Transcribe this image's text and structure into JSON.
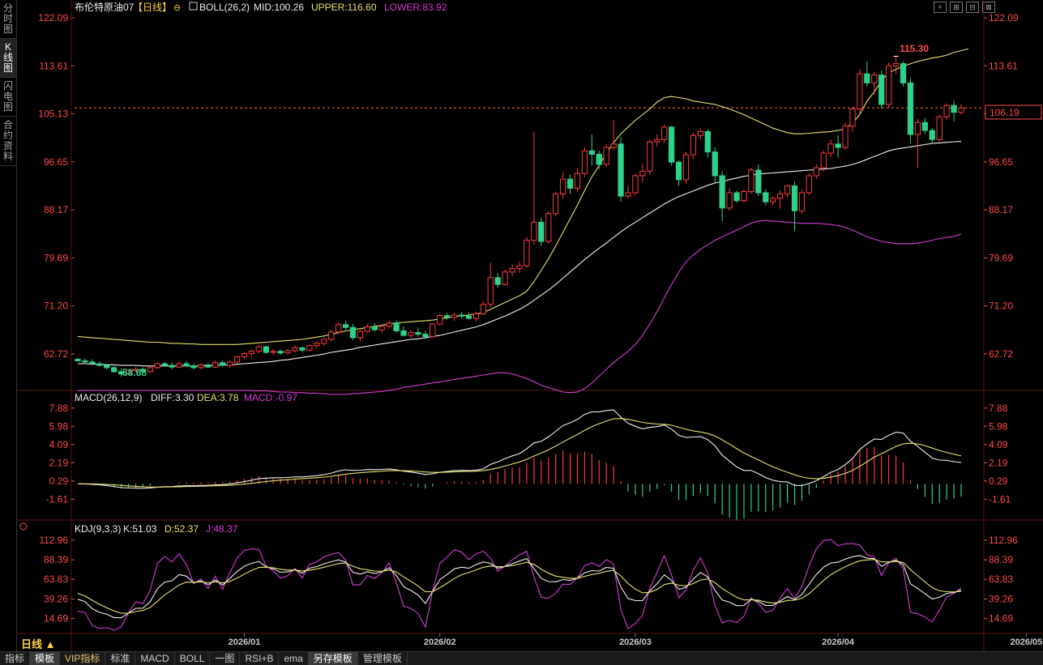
{
  "sidebar": {
    "tabs": [
      {
        "label": "分时图",
        "active": false
      },
      {
        "label": "K线图",
        "active": true
      },
      {
        "label": "闪电图",
        "active": false
      },
      {
        "label": "合约资料",
        "active": false
      }
    ]
  },
  "window_controls": [
    "+",
    "⊞",
    "⊟",
    "⊠"
  ],
  "main_panel": {
    "instrument": "布伦特原油07",
    "period": "【日线】",
    "indicator": "BOLL(26,2)",
    "mid": "MID:100.26",
    "upper": "UPPER:116.60",
    "lower": "LOWER:83.92",
    "current_price": "106.19",
    "high_label": "115.30",
    "low_label": "58.68"
  },
  "macd_panel": {
    "name": "MACD(26,12,9)",
    "diff": "DIFF:3.30",
    "dea": "DEA:3.78",
    "macd": "MACD:-0.97"
  },
  "kdj_panel": {
    "name": "KDJ(9,3,3)",
    "k": "K:51.03",
    "d": "D:52.37",
    "j": "J:48.37"
  },
  "ribbon_label": "日线",
  "bottom_tabs": [
    {
      "label": "指标",
      "style": ""
    },
    {
      "label": "模板",
      "style": "hl"
    },
    {
      "label": "VIP指标",
      "style": "vip"
    },
    {
      "label": "标准",
      "style": ""
    },
    {
      "label": "MACD",
      "style": ""
    },
    {
      "label": "BOLL",
      "style": ""
    },
    {
      "label": "一图",
      "style": ""
    },
    {
      "label": "RSI+B",
      "style": ""
    },
    {
      "label": "ema",
      "style": ""
    },
    {
      "label": "另存模板",
      "style": "hl"
    },
    {
      "label": "管理模板",
      "style": ""
    }
  ],
  "colors": {
    "up": "#ff3b3b",
    "down": "#2ed18a",
    "upper": "#e9e36a",
    "mid": "#f0f0f0",
    "lower": "#d63cd6",
    "diff": "#f0f0f0",
    "dea": "#e9e36a",
    "k": "#f0f0f0",
    "d": "#e9e36a",
    "j": "#d63cd6",
    "axis_text": "#ff4a4a",
    "grid": "#3a1010"
  },
  "chart_data": [
    {
      "type": "candlestick",
      "name": "main",
      "yticks": [
        62.72,
        71.2,
        79.69,
        88.17,
        96.65,
        105.13,
        113.61,
        122.09
      ],
      "ytick_labels": [
        "62.72",
        "71.20",
        "79.69",
        "88.17",
        "96.65",
        "105.13",
        "113.61",
        "122.09"
      ],
      "ylim": [
        58.0,
        122.09
      ],
      "x_labels": [
        {
          "index": 23,
          "label": "2026/01"
        },
        {
          "index": 50,
          "label": "2026/02"
        },
        {
          "index": 77,
          "label": "2026/03"
        },
        {
          "index": 105,
          "label": "2026/04"
        },
        {
          "index": 131,
          "label": "2026/05"
        }
      ],
      "ohlc": [
        [
          61.8,
          62.0,
          61.4,
          61.5
        ],
        [
          61.5,
          61.9,
          61.0,
          61.3
        ],
        [
          61.3,
          61.8,
          60.9,
          61.0
        ],
        [
          61.0,
          61.4,
          60.5,
          60.7
        ],
        [
          60.7,
          61.0,
          60.0,
          60.3
        ],
        [
          60.3,
          60.6,
          59.4,
          59.6
        ],
        [
          59.6,
          60.2,
          58.7,
          59.2
        ],
        [
          59.2,
          60.0,
          59.0,
          59.8
        ],
        [
          59.8,
          60.4,
          59.5,
          60.0
        ],
        [
          60.0,
          60.3,
          59.4,
          59.6
        ],
        [
          59.6,
          60.5,
          59.4,
          60.3
        ],
        [
          60.3,
          61.2,
          60.1,
          61.0
        ],
        [
          61.0,
          61.3,
          60.5,
          60.7
        ],
        [
          60.7,
          61.2,
          60.0,
          60.4
        ],
        [
          60.4,
          61.4,
          60.2,
          61.0
        ],
        [
          61.0,
          61.5,
          60.4,
          60.6
        ],
        [
          60.6,
          61.0,
          60.0,
          60.3
        ],
        [
          60.3,
          61.0,
          60.1,
          60.8
        ],
        [
          60.8,
          61.0,
          60.3,
          60.4
        ],
        [
          60.4,
          61.6,
          60.2,
          61.2
        ],
        [
          61.2,
          61.6,
          60.5,
          60.7
        ],
        [
          60.7,
          61.5,
          60.2,
          61.3
        ],
        [
          61.3,
          62.4,
          61.0,
          62.2
        ],
        [
          62.2,
          63.0,
          61.8,
          62.8
        ],
        [
          62.8,
          63.5,
          62.2,
          63.2
        ],
        [
          63.2,
          64.4,
          62.8,
          64.0
        ],
        [
          64.0,
          64.2,
          62.8,
          63.0
        ],
        [
          63.0,
          63.6,
          62.5,
          63.2
        ],
        [
          63.2,
          63.5,
          62.6,
          62.9
        ],
        [
          62.9,
          63.6,
          62.6,
          63.3
        ],
        [
          63.3,
          64.2,
          63.0,
          63.8
        ],
        [
          63.8,
          64.0,
          63.0,
          63.4
        ],
        [
          63.4,
          64.4,
          63.2,
          64.2
        ],
        [
          64.2,
          65.0,
          63.8,
          64.6
        ],
        [
          64.6,
          65.6,
          64.2,
          65.3
        ],
        [
          65.3,
          67.0,
          65.0,
          66.6
        ],
        [
          66.6,
          68.3,
          66.2,
          67.9
        ],
        [
          67.9,
          68.6,
          67.0,
          67.4
        ],
        [
          67.4,
          68.0,
          65.2,
          65.6
        ],
        [
          65.6,
          67.0,
          65.0,
          66.7
        ],
        [
          66.7,
          68.0,
          66.4,
          67.5
        ],
        [
          67.5,
          68.2,
          66.6,
          67.0
        ],
        [
          67.0,
          68.0,
          66.5,
          67.6
        ],
        [
          67.6,
          68.6,
          67.2,
          68.2
        ],
        [
          68.2,
          68.7,
          66.5,
          66.8
        ],
        [
          66.8,
          67.6,
          65.8,
          66.0
        ],
        [
          66.0,
          67.0,
          65.6,
          66.5
        ],
        [
          66.5,
          67.4,
          65.8,
          66.2
        ],
        [
          66.2,
          66.8,
          65.4,
          65.8
        ],
        [
          65.8,
          68.2,
          65.6,
          68.0
        ],
        [
          68.0,
          69.8,
          67.8,
          69.5
        ],
        [
          69.5,
          70.0,
          68.8,
          69.2
        ],
        [
          69.2,
          70.0,
          68.6,
          69.6
        ],
        [
          69.6,
          70.2,
          69.0,
          69.4
        ],
        [
          69.4,
          70.0,
          68.8,
          69.0
        ],
        [
          69.0,
          70.2,
          68.4,
          69.8
        ],
        [
          69.8,
          72.0,
          69.6,
          71.5
        ],
        [
          71.5,
          78.8,
          71.0,
          76.2
        ],
        [
          76.2,
          77.0,
          74.4,
          75.0
        ],
        [
          75.0,
          77.6,
          74.8,
          77.2
        ],
        [
          77.2,
          78.6,
          76.4,
          77.8
        ],
        [
          77.8,
          79.0,
          77.0,
          78.3
        ],
        [
          78.3,
          83.4,
          78.0,
          82.8
        ],
        [
          82.8,
          102.0,
          82.0,
          86.0
        ],
        [
          86.0,
          86.8,
          81.8,
          82.6
        ],
        [
          82.6,
          88.0,
          82.2,
          87.5
        ],
        [
          87.5,
          91.4,
          87.0,
          91.0
        ],
        [
          91.0,
          94.8,
          90.2,
          93.6
        ],
        [
          93.6,
          94.4,
          91.0,
          92.0
        ],
        [
          92.0,
          95.6,
          91.4,
          94.6
        ],
        [
          94.6,
          99.2,
          94.0,
          98.6
        ],
        [
          98.6,
          101.5,
          96.0,
          98.0
        ],
        [
          98.0,
          98.6,
          95.4,
          96.2
        ],
        [
          96.2,
          99.8,
          95.8,
          99.2
        ],
        [
          99.2,
          104.0,
          98.8,
          99.8
        ],
        [
          99.8,
          101.0,
          89.6,
          90.6
        ],
        [
          90.6,
          92.4,
          90.2,
          91.2
        ],
        [
          91.2,
          94.6,
          90.8,
          94.2
        ],
        [
          94.2,
          96.4,
          93.0,
          95.0
        ],
        [
          95.0,
          100.6,
          94.4,
          100.2
        ],
        [
          100.2,
          101.5,
          99.4,
          100.6
        ],
        [
          100.6,
          103.2,
          100.0,
          102.8
        ],
        [
          102.8,
          103.0,
          96.0,
          96.6
        ],
        [
          96.6,
          97.0,
          92.4,
          93.5
        ],
        [
          93.5,
          98.4,
          92.8,
          97.9
        ],
        [
          97.9,
          101.8,
          97.2,
          101.3
        ],
        [
          101.3,
          102.6,
          100.6,
          102.0
        ],
        [
          102.0,
          102.4,
          97.4,
          98.4
        ],
        [
          98.4,
          99.2,
          93.0,
          94.2
        ],
        [
          94.2,
          95.0,
          86.2,
          88.5
        ],
        [
          88.5,
          92.0,
          88.0,
          91.2
        ],
        [
          91.2,
          91.6,
          89.4,
          89.8
        ],
        [
          89.8,
          91.8,
          89.4,
          91.4
        ],
        [
          91.4,
          95.6,
          91.0,
          95.2
        ],
        [
          95.2,
          96.2,
          90.6,
          91.2
        ],
        [
          91.2,
          91.8,
          89.0,
          89.6
        ],
        [
          89.6,
          90.6,
          89.0,
          90.2
        ],
        [
          90.2,
          91.6,
          88.4,
          91.0
        ],
        [
          91.0,
          92.8,
          90.4,
          92.4
        ],
        [
          92.4,
          93.2,
          84.4,
          88.0
        ],
        [
          88.0,
          91.8,
          87.6,
          91.2
        ],
        [
          91.2,
          94.6,
          90.8,
          94.2
        ],
        [
          94.2,
          96.2,
          93.6,
          95.6
        ],
        [
          95.6,
          98.6,
          95.0,
          98.2
        ],
        [
          98.2,
          100.6,
          97.6,
          99.8
        ],
        [
          99.8,
          101.4,
          97.4,
          99.2
        ],
        [
          99.2,
          103.6,
          98.8,
          103.0
        ],
        [
          103.0,
          106.4,
          102.0,
          106.0
        ],
        [
          106.0,
          113.0,
          105.2,
          112.2
        ],
        [
          112.2,
          114.4,
          110.0,
          110.6
        ],
        [
          110.6,
          112.6,
          108.6,
          112.0
        ],
        [
          112.0,
          112.8,
          106.0,
          106.8
        ],
        [
          106.8,
          114.2,
          106.2,
          113.6
        ],
        [
          113.6,
          115.3,
          112.2,
          114.0
        ],
        [
          114.0,
          114.4,
          110.0,
          110.6
        ],
        [
          110.6,
          111.4,
          100.0,
          101.5
        ],
        [
          101.5,
          104.2,
          95.6,
          103.6
        ],
        [
          103.6,
          104.4,
          101.6,
          102.2
        ],
        [
          102.2,
          102.6,
          99.8,
          100.6
        ],
        [
          100.6,
          105.0,
          100.2,
          104.6
        ],
        [
          104.6,
          107.0,
          104.0,
          106.6
        ],
        [
          106.6,
          107.4,
          103.8,
          105.4
        ],
        [
          105.4,
          106.8,
          105.0,
          106.19
        ]
      ],
      "bands": {
        "upper": [
          65.8,
          65.7,
          65.6,
          65.5,
          65.4,
          65.3,
          65.2,
          65.1,
          65.0,
          64.9,
          64.8,
          64.8,
          64.7,
          64.6,
          64.6,
          64.5,
          64.5,
          64.4,
          64.4,
          64.4,
          64.4,
          64.4,
          64.4,
          64.5,
          64.6,
          64.7,
          64.8,
          64.9,
          65.0,
          65.1,
          65.2,
          65.3,
          65.5,
          65.7,
          65.9,
          66.2,
          66.5,
          66.8,
          67.0,
          67.2,
          67.4,
          67.6,
          67.8,
          68.0,
          68.2,
          68.3,
          68.4,
          68.5,
          68.6,
          68.7,
          68.9,
          69.1,
          69.3,
          69.5,
          69.6,
          69.8,
          70.0,
          70.6,
          71.2,
          71.8,
          72.4,
          73.0,
          73.8,
          75.5,
          77.5,
          79.5,
          81.8,
          84.2,
          86.6,
          89.0,
          91.6,
          94.0,
          96.0,
          98.2,
          100.0,
          101.6,
          102.8,
          104.0,
          105.0,
          106.0,
          107.2,
          108.0,
          108.2,
          108.0,
          107.8,
          107.4,
          107.2,
          107.0,
          106.8,
          106.4,
          106.0,
          105.5,
          105.0,
          104.4,
          103.8,
          103.2,
          102.6,
          102.2,
          101.8,
          101.6,
          101.6,
          101.7,
          101.8,
          101.9,
          102.0,
          102.2,
          102.5,
          103.5,
          105.0,
          107.4,
          109.0,
          111.0,
          112.4,
          113.0,
          113.5,
          114.0,
          114.4,
          114.7,
          115.0,
          115.2,
          115.5,
          116.0,
          116.3,
          116.6
        ],
        "mid": [
          61.0,
          61.0,
          60.9,
          60.9,
          60.8,
          60.8,
          60.7,
          60.7,
          60.7,
          60.6,
          60.6,
          60.6,
          60.6,
          60.6,
          60.6,
          60.6,
          60.6,
          60.6,
          60.7,
          60.7,
          60.8,
          60.8,
          60.9,
          61.0,
          61.1,
          61.2,
          61.3,
          61.4,
          61.6,
          61.7,
          61.9,
          62.1,
          62.3,
          62.5,
          62.7,
          63.0,
          63.2,
          63.4,
          63.6,
          63.9,
          64.1,
          64.3,
          64.5,
          64.7,
          64.9,
          65.1,
          65.3,
          65.4,
          65.6,
          65.8,
          66.0,
          66.3,
          66.6,
          66.9,
          67.2,
          67.5,
          67.9,
          68.4,
          68.9,
          69.4,
          70.0,
          70.6,
          71.3,
          72.2,
          73.1,
          74.0,
          75.0,
          76.1,
          77.2,
          78.3,
          79.4,
          80.4,
          81.4,
          82.3,
          83.3,
          84.3,
          85.2,
          86.0,
          86.8,
          87.6,
          88.4,
          89.2,
          89.9,
          90.5,
          91.0,
          91.5,
          92.0,
          92.5,
          92.9,
          93.2,
          93.5,
          93.8,
          94.1,
          94.3,
          94.5,
          94.6,
          94.7,
          94.8,
          94.9,
          95.0,
          95.1,
          95.2,
          95.3,
          95.4,
          95.5,
          95.7,
          95.9,
          96.2,
          96.6,
          97.1,
          97.6,
          98.1,
          98.6,
          98.9,
          99.1,
          99.3,
          99.5,
          99.7,
          99.9,
          100.0,
          100.1,
          100.2,
          100.26
        ],
        "lower": [
          56.2,
          56.3,
          56.3,
          56.3,
          56.3,
          56.3,
          56.3,
          56.3,
          56.3,
          56.3,
          56.3,
          56.3,
          56.3,
          56.3,
          56.3,
          56.3,
          56.3,
          56.3,
          56.3,
          56.3,
          56.3,
          56.3,
          56.3,
          56.3,
          56.2,
          56.2,
          56.2,
          56.1,
          56.0,
          56.0,
          55.9,
          55.9,
          55.8,
          55.8,
          55.7,
          55.6,
          55.6,
          55.6,
          55.7,
          55.8,
          55.9,
          56.0,
          56.1,
          56.3,
          56.5,
          56.8,
          57.0,
          57.2,
          57.4,
          57.6,
          57.8,
          58.0,
          58.2,
          58.4,
          58.6,
          58.8,
          59.0,
          59.2,
          59.4,
          59.4,
          59.2,
          58.8,
          58.4,
          57.8,
          57.2,
          56.8,
          56.4,
          56.0,
          55.9,
          56.0,
          56.6,
          57.6,
          58.8,
          60.0,
          61.2,
          62.2,
          63.2,
          64.4,
          66.0,
          68.0,
          70.2,
          72.6,
          75.0,
          77.2,
          79.0,
          80.2,
          81.2,
          82.0,
          82.8,
          83.4,
          84.0,
          84.6,
          85.2,
          85.8,
          86.2,
          86.3,
          86.2,
          86.1,
          86.0,
          85.9,
          85.8,
          85.8,
          85.8,
          85.7,
          85.6,
          85.4,
          85.1,
          84.6,
          84.0,
          83.4,
          83.0,
          82.6,
          82.4,
          82.2,
          82.2,
          82.2,
          82.3,
          82.5,
          82.8,
          83.1,
          83.3,
          83.5,
          83.9
        ]
      }
    },
    {
      "type": "line+bar",
      "name": "macd",
      "yticks": [
        -1.61,
        0.29,
        2.19,
        4.09,
        5.98,
        7.88
      ],
      "ytick_labels": [
        "-1.61",
        "0.29",
        "2.19",
        "4.09",
        "5.98",
        "7.88"
      ],
      "ylim": [
        -3.6,
        8.2
      ]
    },
    {
      "type": "line",
      "name": "kdj",
      "yticks": [
        14.69,
        39.26,
        63.83,
        88.39,
        112.96
      ],
      "ytick_labels": [
        "14.69",
        "39.26",
        "63.83",
        "88.39",
        "112.96"
      ],
      "ylim": [
        -2,
        120
      ]
    }
  ]
}
